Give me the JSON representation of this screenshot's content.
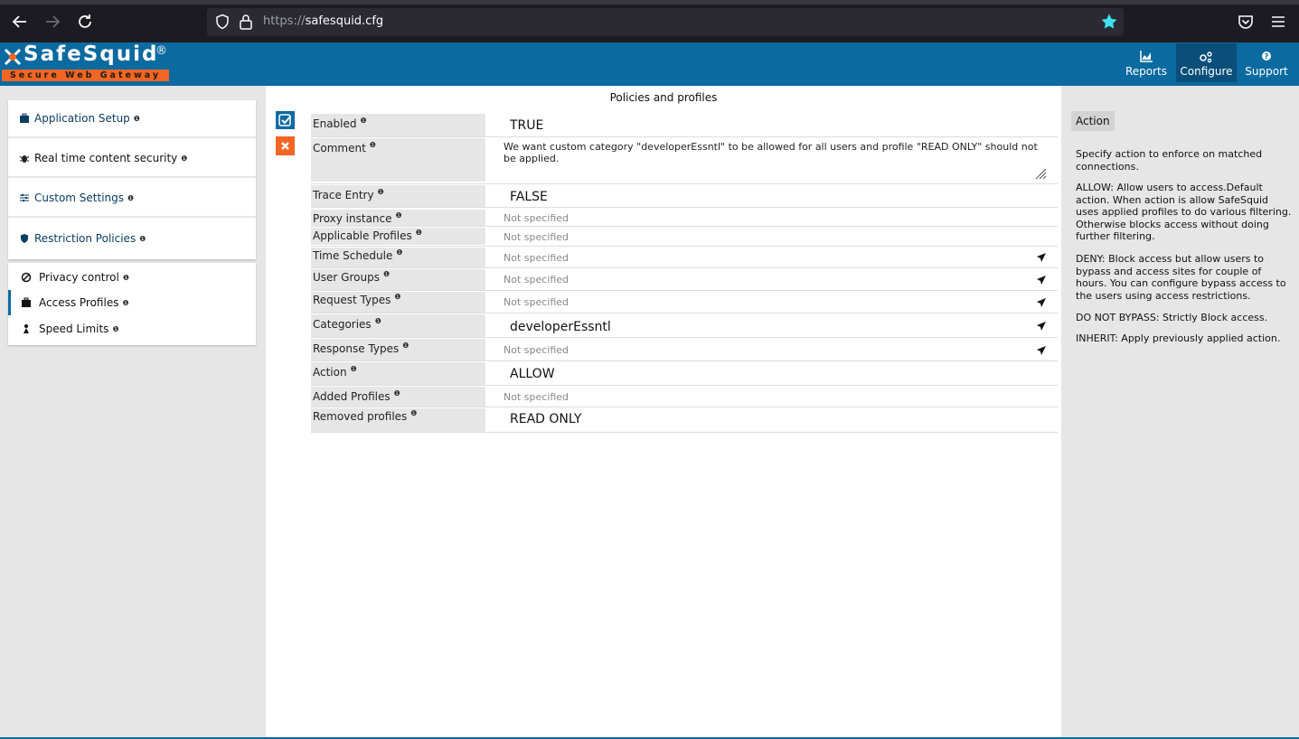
{
  "browser": {
    "url_protocol": "https://",
    "url_host": "safesquid.cfg"
  },
  "header": {
    "logo_text": "SafeSquid",
    "logo_reg": "®",
    "tagline": "Secure Web Gateway",
    "nav": [
      {
        "label": "Reports",
        "icon": "chart-icon"
      },
      {
        "label": "Configure",
        "icon": "cogs-icon"
      },
      {
        "label": "Support",
        "icon": "question-icon"
      }
    ]
  },
  "sidebar": {
    "sections": [
      {
        "label": "Application Setup",
        "icon": "briefcase-icon"
      },
      {
        "label": "Real time content security",
        "icon": "bug-icon"
      },
      {
        "label": "Custom Settings",
        "icon": "sliders-icon"
      },
      {
        "label": "Restriction Policies",
        "icon": "shield-icon"
      }
    ],
    "sub_items": [
      {
        "label": "Privacy control",
        "icon": "ban-icon"
      },
      {
        "label": "Access Profiles",
        "icon": "briefcase-icon"
      },
      {
        "label": "Speed Limits",
        "icon": "speed-icon"
      }
    ]
  },
  "main": {
    "title": "Policies and profiles",
    "rows": [
      {
        "label": "Enabled",
        "value": "TRUE"
      },
      {
        "label": "Comment",
        "value": "We want custom category \"developerEssntl\" to be allowed for all users and profile \"READ ONLY\" should not be applied."
      },
      {
        "label": "Trace Entry",
        "value": "FALSE"
      },
      {
        "label": "Proxy instance",
        "value": "Not specified"
      },
      {
        "label": "Applicable Profiles",
        "value": "Not specified"
      },
      {
        "label": "Time Schedule",
        "value": "Not specified"
      },
      {
        "label": "User Groups",
        "value": "Not specified"
      },
      {
        "label": "Request Types",
        "value": "Not specified"
      },
      {
        "label": "Categories",
        "value": "developerEssntl"
      },
      {
        "label": "Response Types",
        "value": "Not specified"
      },
      {
        "label": "Action",
        "value": "ALLOW"
      },
      {
        "label": "Added Profiles",
        "value": "Not specified"
      },
      {
        "label": "Removed profiles",
        "value": "READ ONLY"
      }
    ]
  },
  "help": {
    "title": "Action",
    "paragraphs": [
      "Specify action to enforce on matched connections.",
      "ALLOW: Allow users to access.Default action. When action is allow SafeSquid uses applied profiles to do various filtering. Otherwise blocks access without doing further filtering.",
      "DENY: Block access but allow users to bypass and access sites for couple of hours. You can configure bypass access to the users using access restrictions.",
      "DO NOT BYPASS: Strictly Block access.",
      "INHERIT: Apply previously applied action."
    ]
  },
  "colors": {
    "brand_blue": "#0b6aa0",
    "brand_orange": "#f26522"
  }
}
